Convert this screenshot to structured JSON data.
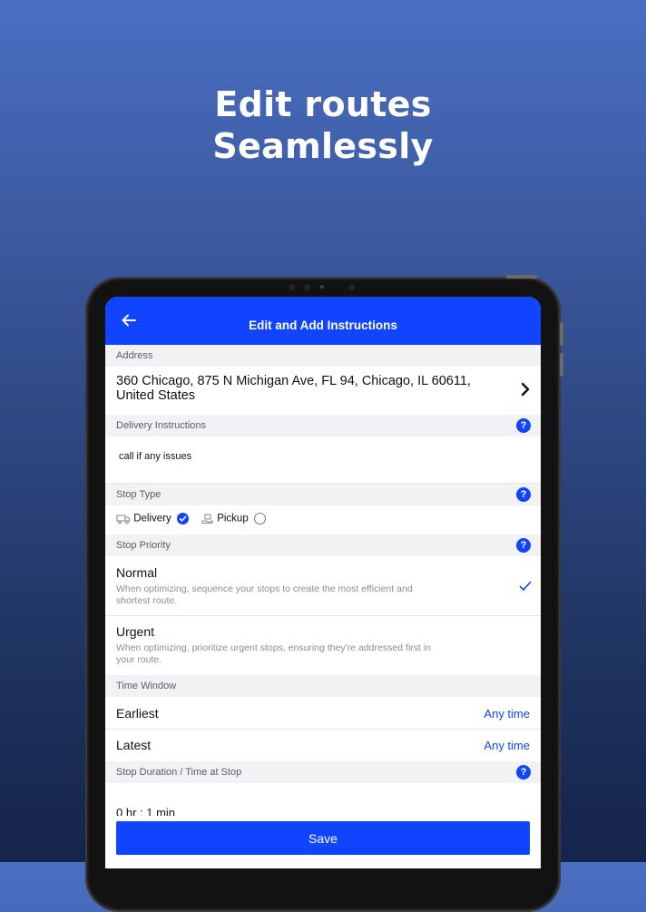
{
  "headline": {
    "line1": "Edit routes",
    "line2": "Seamlessly"
  },
  "appbar": {
    "title": "Edit and Add Instructions"
  },
  "address": {
    "header": "Address",
    "line1": "360 Chicago, 875 N Michigan Ave, FL 94, Chicago, IL 60611,",
    "line2": "United States"
  },
  "delivery_instructions": {
    "header": "Delivery Instructions",
    "value": "call if any issues"
  },
  "stop_type": {
    "header": "Stop Type",
    "options": [
      {
        "label": "Delivery",
        "selected": true,
        "icon": "truck-icon"
      },
      {
        "label": "Pickup",
        "selected": false,
        "icon": "box-hand-icon"
      }
    ]
  },
  "stop_priority": {
    "header": "Stop Priority",
    "options": [
      {
        "title": "Normal",
        "desc1": "When optimizing, sequence your stops to create the most efficient and",
        "desc2": "shortest route.",
        "selected": true
      },
      {
        "title": "Urgent",
        "desc1": "When optimizing, prioritize urgent stops, ensuring they're addressed first in",
        "desc2": "your route.",
        "selected": false
      }
    ]
  },
  "time_window": {
    "header": "Time Window",
    "earliest_label": "Earliest",
    "earliest_value": "Any time",
    "latest_label": "Latest",
    "latest_value": "Any time"
  },
  "stop_duration": {
    "header": "Stop Duration / Time at Stop",
    "value": "0 hr : 1 min"
  },
  "help_glyph": "?",
  "save_label": "Save",
  "colors": {
    "accent": "#1144ff",
    "section_bg": "#f2f2f4",
    "muted_text": "#8c8c94"
  }
}
